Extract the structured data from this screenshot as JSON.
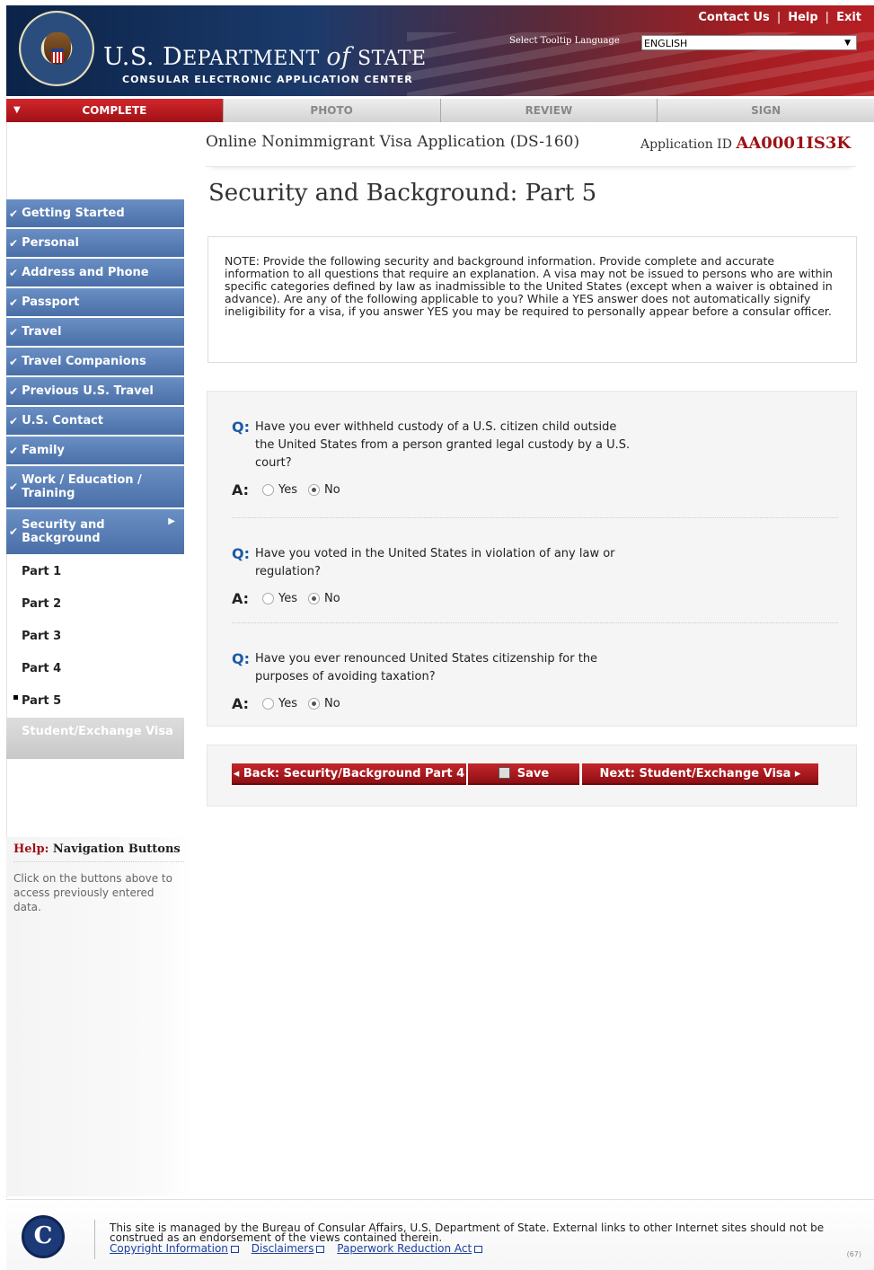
{
  "header": {
    "department_name": "U.S. DEPARTMENT of STATE",
    "department_prefix": "U.S. D",
    "department_mid": "EPARTMENT ",
    "department_of": "of",
    "department_state": " STATE",
    "subtitle": "CONSULAR ELECTRONIC APPLICATION CENTER",
    "top_links": [
      "Contact Us",
      "Help",
      "Exit"
    ],
    "tooltip_language_label": "Select Tooltip Language",
    "tooltip_language_value": "ENGLISH"
  },
  "tabs": [
    {
      "label": "COMPLETE",
      "active": true
    },
    {
      "label": "PHOTO",
      "active": false
    },
    {
      "label": "REVIEW",
      "active": false
    },
    {
      "label": "SIGN",
      "active": false
    }
  ],
  "application": {
    "title": "Online Nonimmigrant Visa Application (DS-160)",
    "id_label": "Application ID",
    "id_value": "AA0001IS3K"
  },
  "sidebar": {
    "sections": [
      "Getting Started",
      "Personal",
      "Address and Phone",
      "Passport",
      "Travel",
      "Travel Companions",
      "Previous U.S. Travel",
      "U.S. Contact",
      "Family",
      "Work / Education / Training",
      "Security and Background"
    ],
    "sub_items": [
      "Part 1",
      "Part 2",
      "Part 3",
      "Part 4",
      "Part 5"
    ],
    "current_sub": "Part 5",
    "next_section": "Student/Exchange Visa"
  },
  "page": {
    "title": "Security and Background: Part 5",
    "note": "NOTE: Provide the following security and background information. Provide complete and accurate information to all questions that require an explanation. A visa may not be issued to persons who are within specific categories defined by law as inadmissible to the United States (except when a waiver is obtained in advance). Are any of the following applicable to you? While a YES answer does not automatically signify ineligibility for a visa, if you answer YES you may be required to personally appear before a consular officer."
  },
  "questions": [
    {
      "q_label": "Q:",
      "text": "Have you ever withheld custody of a U.S. citizen child outside the United States from a person granted legal custody by a U.S. court?",
      "a_label": "A:",
      "yes": "Yes",
      "no": "No",
      "answer": "No"
    },
    {
      "q_label": "Q:",
      "text": "Have you voted in the United States in violation of any law or regulation?",
      "a_label": "A:",
      "yes": "Yes",
      "no": "No",
      "answer": "No"
    },
    {
      "q_label": "Q:",
      "text": "Have you ever renounced United States citizenship for the purposes of avoiding taxation?",
      "a_label": "A:",
      "yes": "Yes",
      "no": "No",
      "answer": "No"
    }
  ],
  "buttons": {
    "back": "◂ Back: Security/Background Part 4",
    "save": "Save",
    "next": "Next: Student/Exchange Visa ▸"
  },
  "help": {
    "title_prefix": "Help:",
    "title": "Navigation Buttons",
    "text": "Click on the buttons above to access previously entered data."
  },
  "footer": {
    "logo_letter": "C",
    "text": "This site is managed by the Bureau of Consular Affairs, U.S. Department of State. External links to other Internet sites should not be construed as an endorsement of the views contained therein.",
    "links": [
      "Copyright Information",
      "Disclaimers",
      "Paperwork Reduction Act"
    ],
    "code": "(67)"
  },
  "colors": {
    "brand_red": "#9e1116",
    "nav_blue": "#5077b3",
    "link_blue": "#1a3fa0",
    "q_blue": "#1b5aa6"
  }
}
